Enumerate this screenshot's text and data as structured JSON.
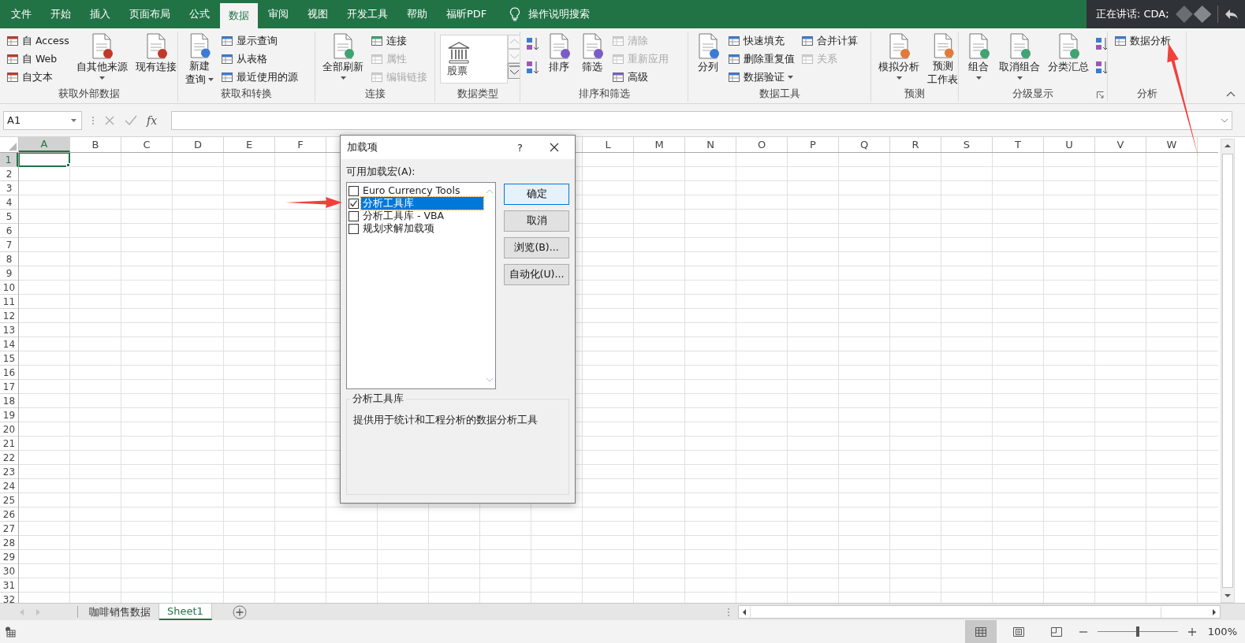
{
  "titlebar": {
    "tabs": [
      {
        "label": "文件",
        "selected": false
      },
      {
        "label": "开始",
        "selected": false
      },
      {
        "label": "插入",
        "selected": false
      },
      {
        "label": "页面布局",
        "selected": false
      },
      {
        "label": "公式",
        "selected": false
      },
      {
        "label": "数据",
        "selected": true
      },
      {
        "label": "审阅",
        "selected": false
      },
      {
        "label": "视图",
        "selected": false
      },
      {
        "label": "开发工具",
        "selected": false
      },
      {
        "label": "帮助",
        "selected": false
      },
      {
        "label": "福昕PDF",
        "selected": false
      }
    ],
    "tell_me": "操作说明搜索",
    "presence": "正在讲话: CDA;"
  },
  "ribbon": {
    "groups": [
      {
        "label": "获取外部数据",
        "columns": [
          {
            "kind": "small",
            "items": [
              {
                "label": "自 Access",
                "disabled": false
              },
              {
                "label": "自 Web",
                "disabled": false
              },
              {
                "label": "自文本",
                "disabled": false
              }
            ]
          },
          {
            "kind": "large",
            "items": [
              {
                "lines": [
                  "自其他来源"
                ],
                "dropdown": true
              }
            ]
          },
          {
            "kind": "large",
            "items": [
              {
                "lines": [
                  "现有连接"
                ],
                "dropdown": false
              }
            ]
          }
        ]
      },
      {
        "label": "获取和转换",
        "columns": [
          {
            "kind": "large",
            "items": [
              {
                "lines": [
                  "新建",
                  "查询"
                ],
                "dropdown": true
              }
            ]
          },
          {
            "kind": "small",
            "items": [
              {
                "label": "显示查询",
                "disabled": false
              },
              {
                "label": "从表格",
                "disabled": false
              },
              {
                "label": "最近使用的源",
                "disabled": false
              }
            ]
          }
        ]
      },
      {
        "label": "连接",
        "columns": [
          {
            "kind": "large",
            "items": [
              {
                "lines": [
                  "全部刷新"
                ],
                "dropdown": true
              }
            ]
          },
          {
            "kind": "small",
            "items": [
              {
                "label": "连接",
                "disabled": false
              },
              {
                "label": "属性",
                "disabled": true
              },
              {
                "label": "编辑链接",
                "disabled": true
              }
            ]
          }
        ]
      },
      {
        "label": "数据类型",
        "columns": [
          {
            "kind": "gallery",
            "items": [
              {
                "lines": [
                  "股票"
                ]
              }
            ]
          }
        ]
      },
      {
        "label": "排序和筛选",
        "columns": [
          {
            "kind": "icon-pair"
          },
          {
            "kind": "large",
            "items": [
              {
                "lines": [
                  "排序"
                ],
                "dropdown": false
              }
            ]
          },
          {
            "kind": "large",
            "items": [
              {
                "lines": [
                  "筛选"
                ],
                "dropdown": false
              }
            ]
          },
          {
            "kind": "small",
            "items": [
              {
                "label": "清除",
                "disabled": true
              },
              {
                "label": "重新应用",
                "disabled": true
              },
              {
                "label": "高级",
                "disabled": false
              }
            ]
          }
        ]
      },
      {
        "label": "数据工具",
        "columns": [
          {
            "kind": "large",
            "items": [
              {
                "lines": [
                  "分列"
                ],
                "dropdown": false
              }
            ]
          },
          {
            "kind": "small",
            "items": [
              {
                "label": "快速填充",
                "disabled": false
              },
              {
                "label": "删除重复值",
                "disabled": false
              },
              {
                "label": "数据验证",
                "disabled": false,
                "dropdown": true
              }
            ]
          },
          {
            "kind": "small",
            "items": [
              {
                "label": "合并计算",
                "disabled": false
              },
              {
                "label": "关系",
                "disabled": true
              }
            ]
          }
        ]
      },
      {
        "label": "预测",
        "columns": [
          {
            "kind": "large",
            "items": [
              {
                "lines": [
                  "模拟分析"
                ],
                "dropdown": true
              }
            ]
          },
          {
            "kind": "large",
            "items": [
              {
                "lines": [
                  "预测",
                  "工作表"
                ],
                "dropdown": false
              }
            ]
          }
        ]
      },
      {
        "label": "分级显示",
        "dialog_launcher": true,
        "columns": [
          {
            "kind": "large",
            "items": [
              {
                "lines": [
                  "组合"
                ],
                "dropdown": true
              }
            ]
          },
          {
            "kind": "large",
            "items": [
              {
                "lines": [
                  "取消组合"
                ],
                "dropdown": true
              }
            ]
          },
          {
            "kind": "large",
            "items": [
              {
                "lines": [
                  "分类汇总"
                ],
                "dropdown": false
              }
            ]
          },
          {
            "kind": "icon-pair"
          }
        ]
      },
      {
        "label": "分析",
        "columns": [
          {
            "kind": "small",
            "items": [
              {
                "label": "数据分析",
                "disabled": false
              }
            ]
          }
        ]
      }
    ]
  },
  "formula_bar": {
    "name_box": "A1",
    "fx": "fx"
  },
  "grid": {
    "columns": [
      {
        "label": "A",
        "selected": true
      },
      {
        "label": "B",
        "selected": false
      },
      {
        "label": "C",
        "selected": false
      },
      {
        "label": "D",
        "selected": false
      },
      {
        "label": "E",
        "selected": false
      },
      {
        "label": "F",
        "selected": false
      },
      {
        "label": "L",
        "selected": false
      },
      {
        "label": "M",
        "selected": false
      },
      {
        "label": "N",
        "selected": false
      },
      {
        "label": "O",
        "selected": false
      },
      {
        "label": "P",
        "selected": false
      },
      {
        "label": "Q",
        "selected": false
      },
      {
        "label": "R",
        "selected": false
      },
      {
        "label": "S",
        "selected": false
      },
      {
        "label": "T",
        "selected": false
      },
      {
        "label": "U",
        "selected": false
      },
      {
        "label": "V",
        "selected": false
      },
      {
        "label": "W",
        "selected": false
      }
    ],
    "rows": [
      {
        "label": "1",
        "selected": true
      },
      {
        "label": "2",
        "selected": false
      },
      {
        "label": "3",
        "selected": false
      },
      {
        "label": "4",
        "selected": false
      },
      {
        "label": "5",
        "selected": false
      },
      {
        "label": "6",
        "selected": false
      },
      {
        "label": "7",
        "selected": false
      },
      {
        "label": "8",
        "selected": false
      },
      {
        "label": "9",
        "selected": false
      },
      {
        "label": "10",
        "selected": false
      },
      {
        "label": "11",
        "selected": false
      },
      {
        "label": "12",
        "selected": false
      },
      {
        "label": "13",
        "selected": false
      },
      {
        "label": "14",
        "selected": false
      },
      {
        "label": "15",
        "selected": false
      },
      {
        "label": "16",
        "selected": false
      },
      {
        "label": "17",
        "selected": false
      },
      {
        "label": "18",
        "selected": false
      },
      {
        "label": "19",
        "selected": false
      },
      {
        "label": "20",
        "selected": false
      },
      {
        "label": "21",
        "selected": false
      },
      {
        "label": "22",
        "selected": false
      },
      {
        "label": "23",
        "selected": false
      },
      {
        "label": "24",
        "selected": false
      },
      {
        "label": "25",
        "selected": false
      },
      {
        "label": "26",
        "selected": false
      },
      {
        "label": "27",
        "selected": false
      },
      {
        "label": "28",
        "selected": false
      },
      {
        "label": "29",
        "selected": false
      },
      {
        "label": "30",
        "selected": false
      },
      {
        "label": "31",
        "selected": false
      },
      {
        "label": "32",
        "selected": false
      }
    ]
  },
  "dialog": {
    "title": "加载项",
    "help": "?",
    "list_label": "可用加载宏(A):",
    "addins": [
      {
        "label": "Euro Currency Tools",
        "checked": false,
        "selected": false
      },
      {
        "label": "分析工具库",
        "checked": true,
        "selected": true
      },
      {
        "label": "分析工具库 - VBA",
        "checked": false,
        "selected": false
      },
      {
        "label": "规划求解加载项",
        "checked": false,
        "selected": false
      }
    ],
    "buttons": [
      {
        "label": "确定",
        "default": true
      },
      {
        "label": "取消",
        "default": false
      },
      {
        "label": "浏览(B)...",
        "default": false
      },
      {
        "label": "自动化(U)...",
        "default": false
      }
    ],
    "description_title": "分析工具库",
    "description": "提供用于统计和工程分析的数据分析工具"
  },
  "sheets": [
    {
      "label": "咖啡销售数据",
      "selected": false
    },
    {
      "label": "Sheet1",
      "selected": true
    }
  ],
  "status_bar": {
    "views": [
      {
        "kind": "normal",
        "selected": true
      },
      {
        "kind": "page-layout",
        "selected": false
      },
      {
        "kind": "page-break",
        "selected": false
      }
    ],
    "zoom": {
      "level": 0.5,
      "reading": "100%"
    }
  }
}
